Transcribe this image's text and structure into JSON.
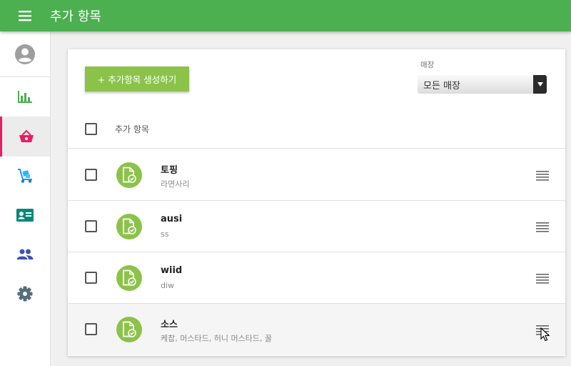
{
  "app": {
    "title": "추가 항목"
  },
  "sidebar": {
    "items": [
      {
        "icon": "account-icon",
        "active": false
      },
      {
        "icon": "bar-chart-icon",
        "active": false
      },
      {
        "icon": "basket-icon",
        "active": true
      },
      {
        "icon": "hand-truck-icon",
        "active": false
      },
      {
        "icon": "id-card-icon",
        "active": false
      },
      {
        "icon": "people-icon",
        "active": false
      },
      {
        "icon": "gear-icon",
        "active": false
      }
    ]
  },
  "toolbar": {
    "create_label": "+ 추가항목 생성하기"
  },
  "store": {
    "label": "매장",
    "value": "모든 매장"
  },
  "list": {
    "header": "추가 항목",
    "rows": [
      {
        "name": "토핑",
        "sub": "라면사리"
      },
      {
        "name": "ausi",
        "sub": "ss"
      },
      {
        "name": "wiid",
        "sub": "diw"
      },
      {
        "name": "소스",
        "sub": "케찹, 머스타드, 허니 머스타드, 꿀"
      }
    ]
  },
  "colors": {
    "topbar": "#4caf50",
    "accent_green": "#8bc34a",
    "active_indicator": "#e91e63"
  }
}
